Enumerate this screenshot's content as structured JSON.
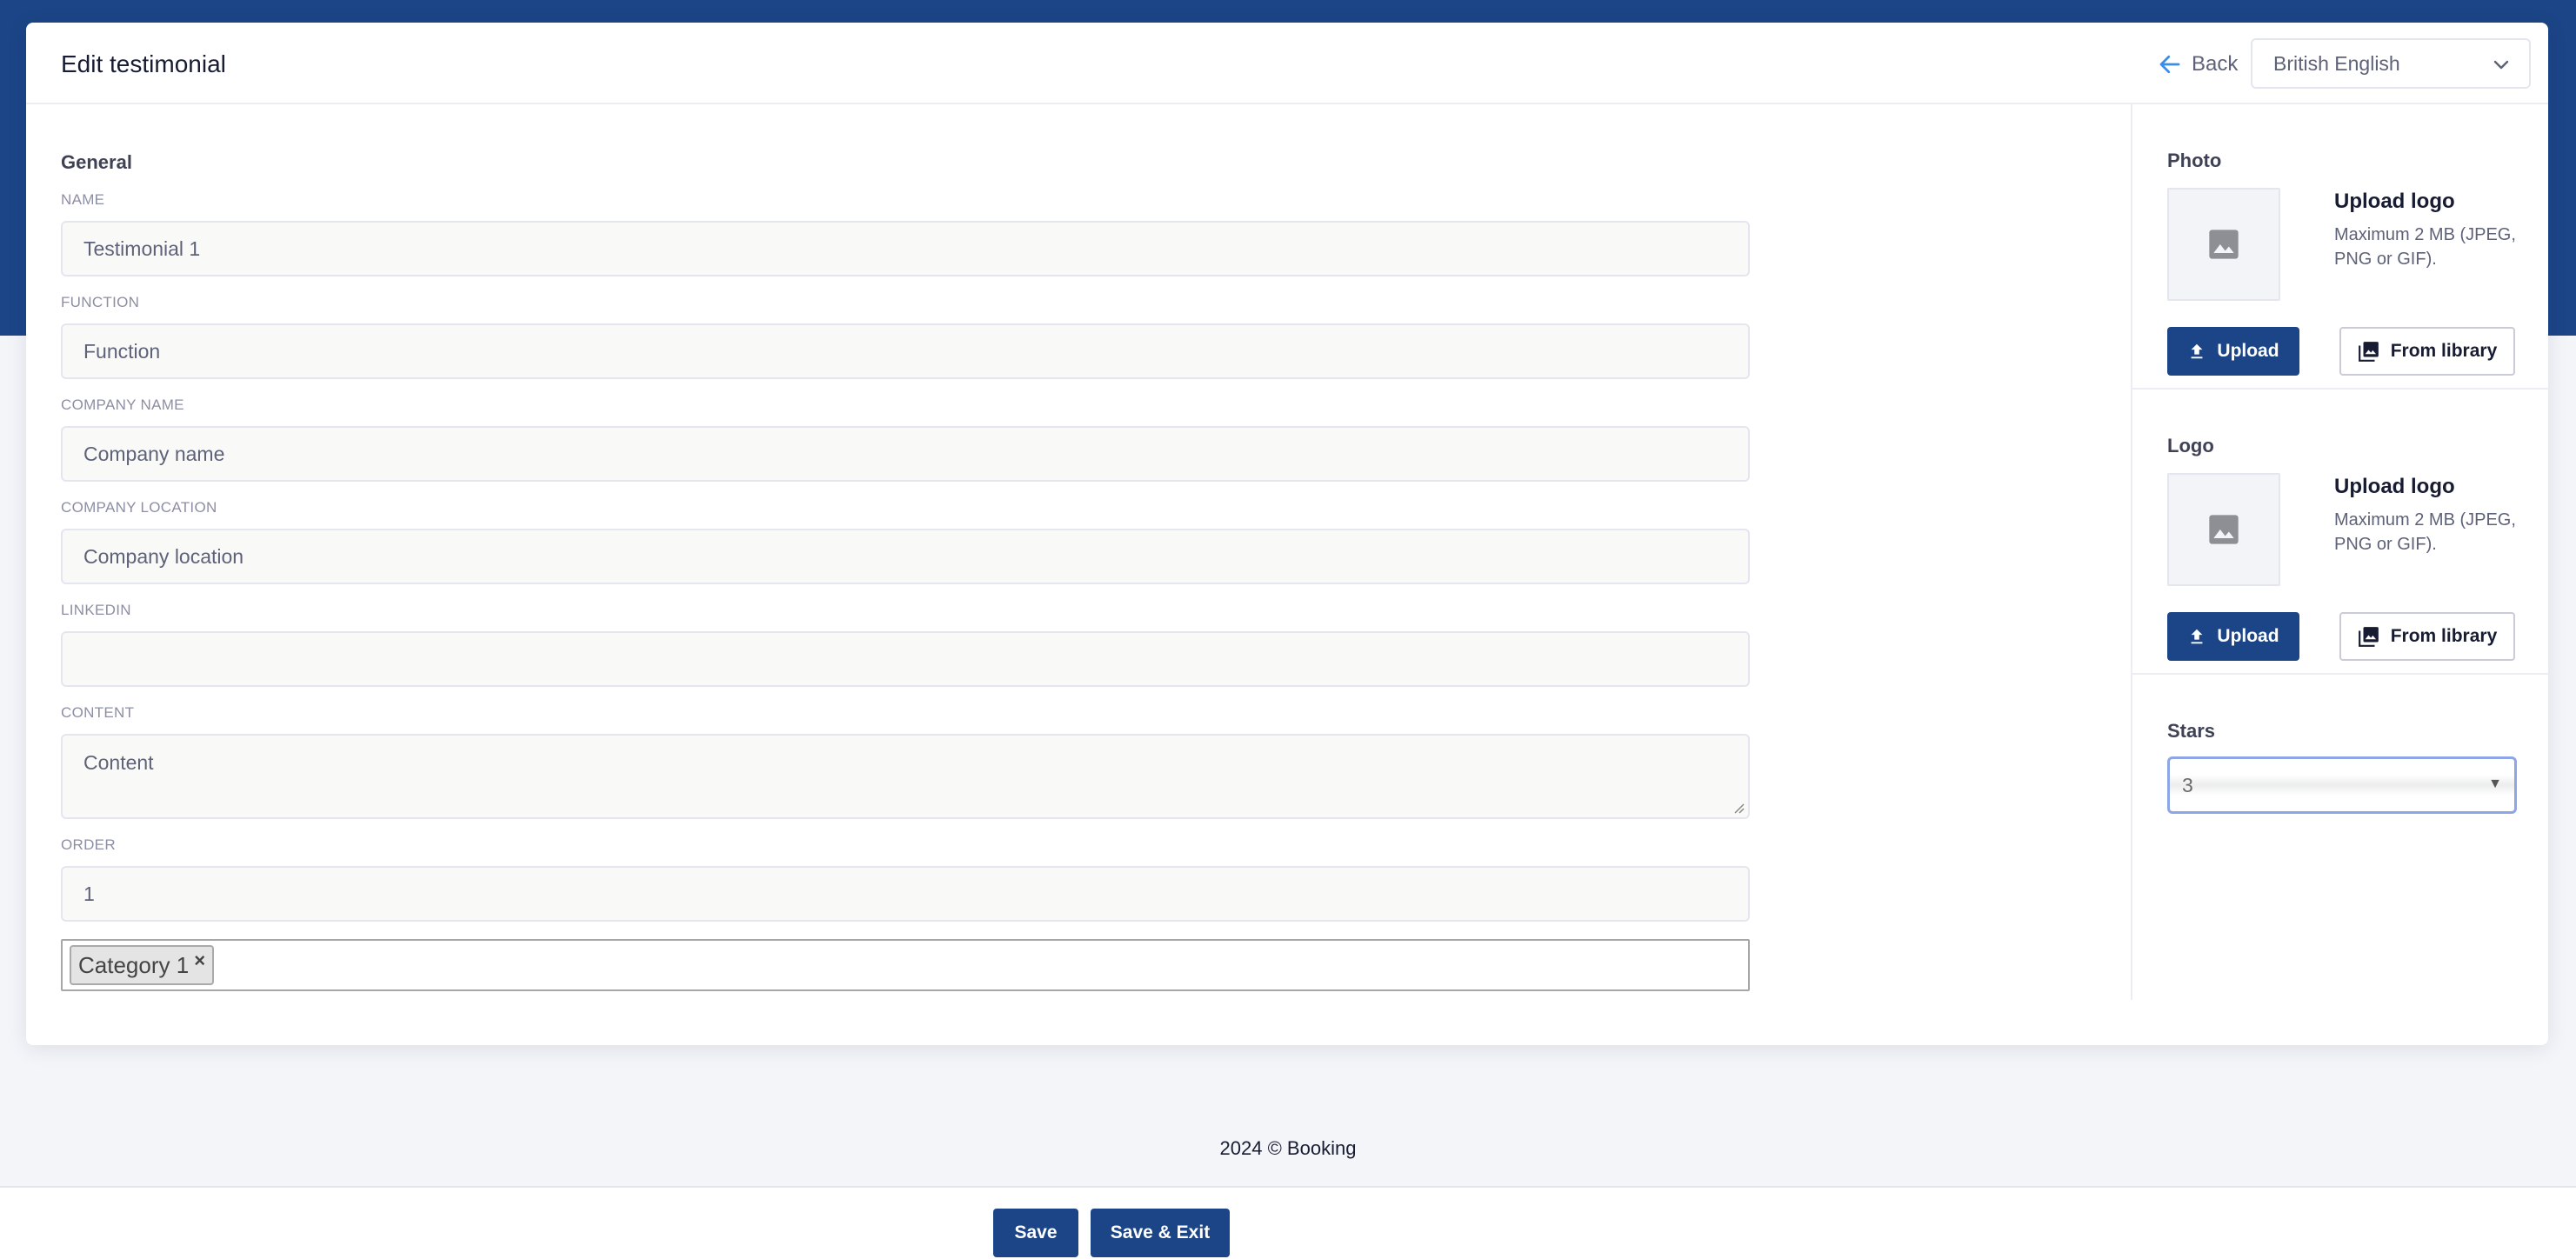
{
  "header": {
    "title": "Edit testimonial",
    "back_label": "Back",
    "language": "British English"
  },
  "general": {
    "section_title": "General",
    "fields": [
      {
        "label": "NAME",
        "value": "Testimonial 1"
      },
      {
        "label": "FUNCTION",
        "placeholder": "Function"
      },
      {
        "label": "COMPANY NAME",
        "placeholder": "Company name"
      },
      {
        "label": "COMPANY LOCATION",
        "placeholder": "Company location"
      },
      {
        "label": "LINKEDIN",
        "placeholder": ""
      },
      {
        "label": "CONTENT",
        "placeholder": "Content"
      },
      {
        "label": "ORDER",
        "value": "1"
      }
    ],
    "categories": [
      "Category 1"
    ],
    "tag_remove_glyph": "×"
  },
  "sidebar": {
    "photo": {
      "title": "Photo",
      "upload_title": "Upload logo",
      "upload_hint": "Maximum 2 MB (JPEG, PNG or GIF).",
      "upload_label": "Upload",
      "library_label": "From library"
    },
    "logo": {
      "title": "Logo",
      "upload_title": "Upload logo",
      "upload_hint": "Maximum 2 MB (JPEG, PNG or GIF).",
      "upload_label": "Upload",
      "library_label": "From library"
    },
    "stars": {
      "title": "Stars",
      "value": "3"
    }
  },
  "footer": {
    "text": "2024 © Booking",
    "save_label": "Save",
    "save_exit_label": "Save & Exit"
  },
  "colors": {
    "brand": "#1c4587",
    "page_bg": "#f4f5f9",
    "focus_border": "#8ea6e6"
  },
  "icons": {
    "back": "arrow-left-icon",
    "language_dropdown": "chevron-down-icon",
    "thumbnail": "image-placeholder-icon",
    "upload": "upload-icon",
    "library": "images-icon",
    "stars_dropdown": "caret-down-icon"
  }
}
